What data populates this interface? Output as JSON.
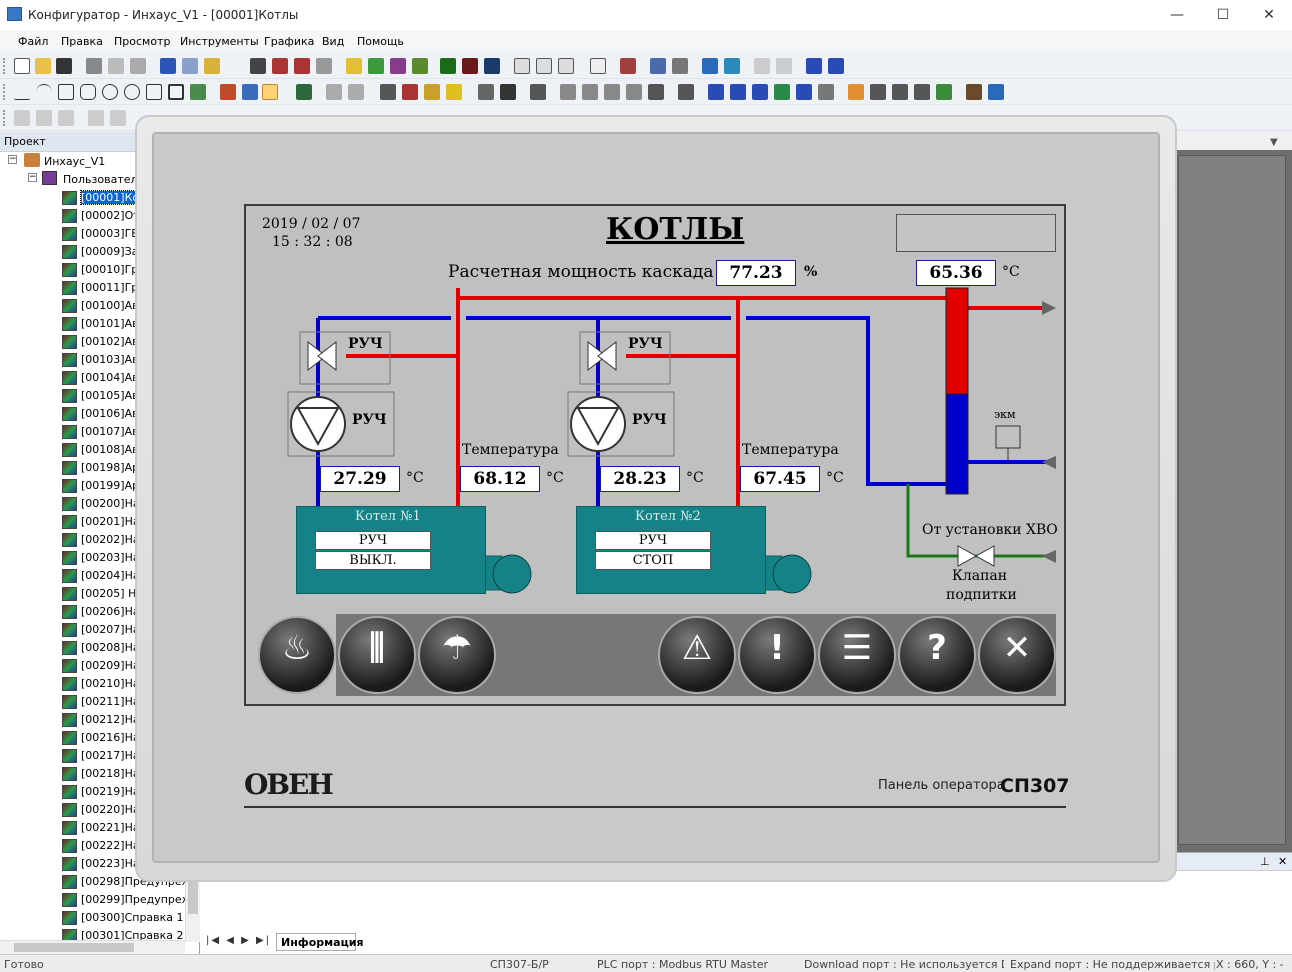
{
  "window": {
    "title": "Конфигуратор - Инхаус_V1 - [00001]Котлы",
    "min": "—",
    "max": "☐",
    "close": "✕"
  },
  "menu": [
    "Файл",
    "Правка",
    "Просмотр",
    "Инструменты",
    "Графика",
    "Вид",
    "Помощь"
  ],
  "project_panel": {
    "title": "Проект",
    "root": "Инхаус_V1",
    "group": "Пользовател",
    "items": [
      "[00001]Ко",
      "[00002]От",
      "[00003]ГВ",
      "[00009]За",
      "[00010]Гр",
      "[00011]Гр",
      "[00100]Ав",
      "[00101]Ав",
      "[00102]Ав",
      "[00103]Ав",
      "[00104]Ав",
      "[00105]Ав",
      "[00106]Ав",
      "[00107]Ав",
      "[00108]Ав",
      "[00198]Ар",
      "[00199]Ар",
      "[00200]На",
      "[00201]На",
      "[00202]На",
      "[00203]На",
      "[00204]На",
      "[00205] Н",
      "[00206]На",
      "[00207]На",
      "[00208]На",
      "[00209]На",
      "[00210]На",
      "[00211]На",
      "[00212]На",
      "[00216]На",
      "[00217]На",
      "[00218]На",
      "[00219]На",
      "[00220]На",
      "[00221]На",
      "[00222]На",
      "[00223]На",
      "[00298]Предупреж",
      "[00299]Предупреж",
      "[00300]Справка 1",
      "[00301]Справка 2"
    ]
  },
  "screen": {
    "date": "2019 / 02 / 07",
    "time": "15 : 32 : 08",
    "title": "КОТЛЫ",
    "cascade_label": "Расчетная мощность каскада",
    "cascade_value": "77.23",
    "cascade_unit": "%",
    "header_temp": "65.36",
    "deg": "°C",
    "manual": "РУЧ",
    "temp_label": "Температура",
    "boiler1": {
      "title": "Котел №1",
      "pump_temp": "27.29",
      "temp": "68.12",
      "mode": "РУЧ",
      "state": "ВЫКЛ."
    },
    "boiler2": {
      "title": "Котел №2",
      "pump_temp": "28.23",
      "temp": "67.45",
      "mode": "РУЧ",
      "state": "СТОП"
    },
    "ekm": "экм",
    "hvo": "От установки ХВО",
    "valve_1": "Клапан",
    "valve_2": "подпитки"
  },
  "device": {
    "logo": "ОВЕН",
    "label": "Панель оператора",
    "model": "СП307"
  },
  "bottom": {
    "tab": "Информация"
  },
  "status": {
    "ready": "Готово",
    "model": "СП307-Б/Р",
    "plc": "PLC порт : Modbus RTU Master",
    "download": "Download порт : Не используется Down",
    "expand": "Expand порт : Не поддерживается расш",
    "coords": "X : 660, Y : -"
  },
  "colors": {
    "hot": "#e00000",
    "cold": "#0000cc",
    "green": "#1a7a1a",
    "boiler": "#148287"
  }
}
